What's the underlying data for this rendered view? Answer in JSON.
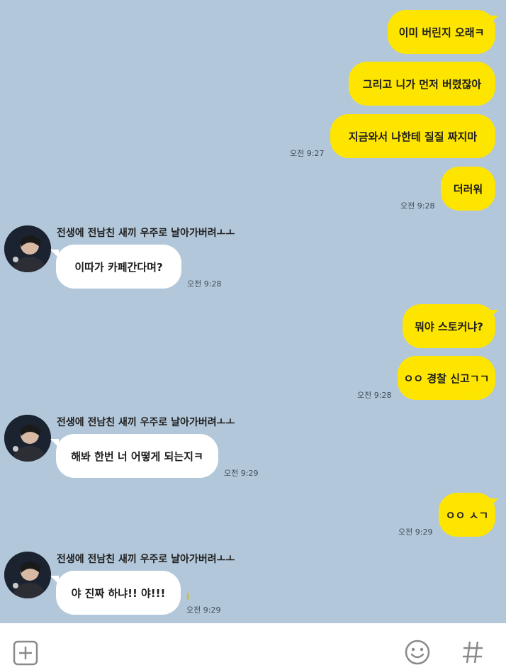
{
  "contact": {
    "name": "전생에 전남친 새끼 우주로 날아가버려ㅗㅗ"
  },
  "messages": {
    "m1": "이미 버린지 오래ㅋ",
    "m2": "그리고 니가 먼저 버렸잖아",
    "m3": "지금와서 나한테 질질 짜지마",
    "m4": "더러워",
    "m5": "이따가 카페간다며?",
    "m6": "뭐야 스토커냐?",
    "m7": "ㅇㅇ 경찰 신고ㄱㄱ",
    "m8": "해봐 한번 너 어떻게 되는지ㅋ",
    "m9": "ㅇㅇ ㅅㄱ",
    "m10": "야 진짜 하냐!! 야!!!"
  },
  "times": {
    "t1": "오전 9:27",
    "t2": "오전 9:28",
    "t3": "오전 9:28",
    "t4": "오전 9:28",
    "t5": "오전 9:29",
    "t6": "오전 9:29",
    "t7": "오전 9:29"
  },
  "input_bar": {
    "add_icon": "plus-square-icon",
    "emoji_icon": "smiley-icon",
    "hash_icon": "hash-icon"
  },
  "colors": {
    "background": "#b2c7da",
    "my_bubble": "#fee500",
    "their_bubble": "#ffffff"
  }
}
